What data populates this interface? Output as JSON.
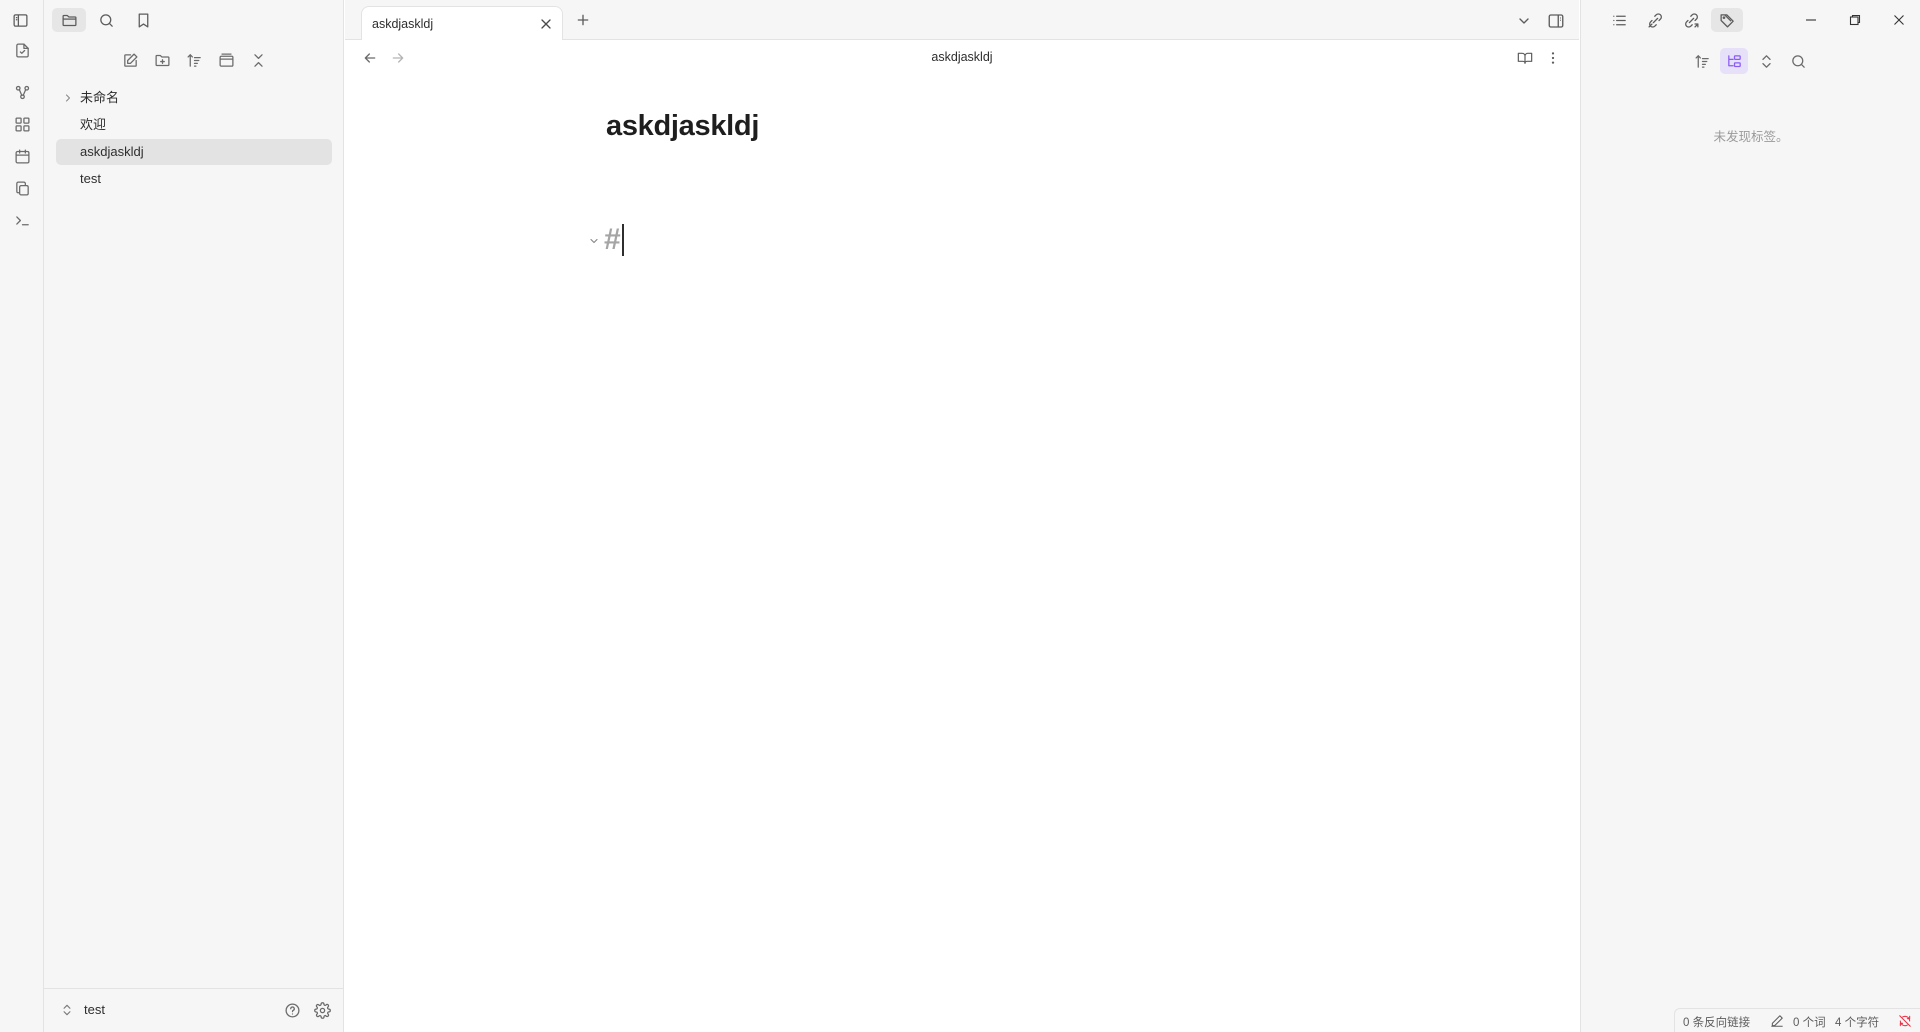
{
  "ribbon": {
    "icons": [
      "file-open-icon",
      "graph-view-icon",
      "canvas-icon",
      "calendar-icon",
      "copy-icon",
      "terminal-icon"
    ]
  },
  "left_sidebar": {
    "top_icons": [
      "sidebar-toggle-icon",
      "folder-icon",
      "search-icon",
      "bookmark-icon"
    ],
    "nav_actions": [
      "new-note-icon",
      "new-folder-icon",
      "sort-icon",
      "collapse-view-icon",
      "collapse-all-icon"
    ],
    "tree": [
      {
        "label": "未命名",
        "type": "folder"
      },
      {
        "label": "欢迎",
        "type": "file"
      },
      {
        "label": "askdjaskldj",
        "type": "file",
        "selected": true
      },
      {
        "label": "test",
        "type": "file"
      }
    ],
    "vault": {
      "name": "test"
    }
  },
  "tabbar": {
    "tabs": [
      {
        "title": "askdjaskldj"
      }
    ]
  },
  "editor": {
    "header_title": "askdjaskldj",
    "note_title": "askdjaskldj",
    "heading_text": "#"
  },
  "right_sidebar": {
    "tabs": [
      "outline-icon",
      "backlinks-icon",
      "outgoing-links-icon",
      "tags-icon"
    ],
    "tag_tools": [
      "sort-icon",
      "tree-view-icon",
      "expand-collapse-icon",
      "search-icon"
    ],
    "empty_message": "未发现标签。"
  },
  "statusbar": {
    "backlinks": "0 条反向链接",
    "words": "0 个词",
    "chars": "4 个字符"
  },
  "colors": {
    "accent": "#8a5cf5",
    "sidebar_bg": "#f6f6f6",
    "error": "#e93147"
  }
}
